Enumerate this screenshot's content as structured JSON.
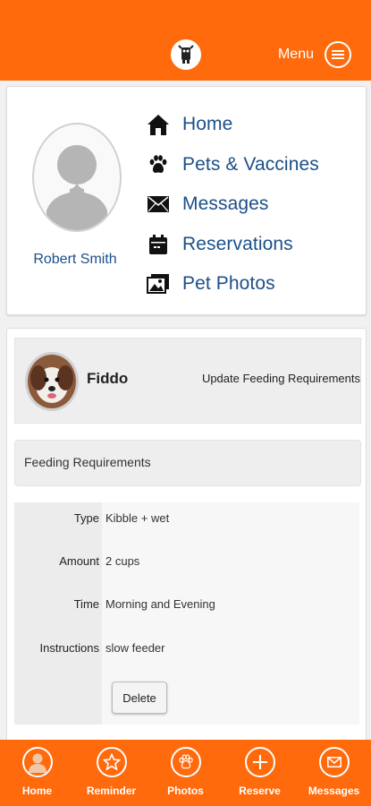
{
  "header": {
    "menu_label": "Menu"
  },
  "profile": {
    "name": "Robert Smith"
  },
  "nav": [
    {
      "label": "Home",
      "icon": "home-icon"
    },
    {
      "label": "Pets & Vaccines",
      "icon": "paw-icon"
    },
    {
      "label": "Messages",
      "icon": "envelope-icon"
    },
    {
      "label": "Reservations",
      "icon": "calendar-icon"
    },
    {
      "label": "Pet Photos",
      "icon": "photos-icon"
    }
  ],
  "pet": {
    "name": "Fiddo",
    "update_label": "Update Feeding Requirements"
  },
  "feeding": {
    "title": "Feeding Requirements",
    "rows": [
      {
        "label": "Type",
        "value": "Kibble + wet"
      },
      {
        "label": "Amount",
        "value": "2 cups"
      },
      {
        "label": "Time",
        "value": "Morning and Evening"
      },
      {
        "label": "Instructions",
        "value": "slow feeder"
      }
    ],
    "delete_label": "Delete"
  },
  "tabs": [
    {
      "label": "Home",
      "icon": "person-icon"
    },
    {
      "label": "Reminder",
      "icon": "star-icon"
    },
    {
      "label": "Photos",
      "icon": "paw-icon"
    },
    {
      "label": "Reserve",
      "icon": "plus-icon"
    },
    {
      "label": "Messages",
      "icon": "envelope-icon"
    }
  ],
  "colors": {
    "brand": "#ff6a0d",
    "link": "#1c4f8a"
  }
}
